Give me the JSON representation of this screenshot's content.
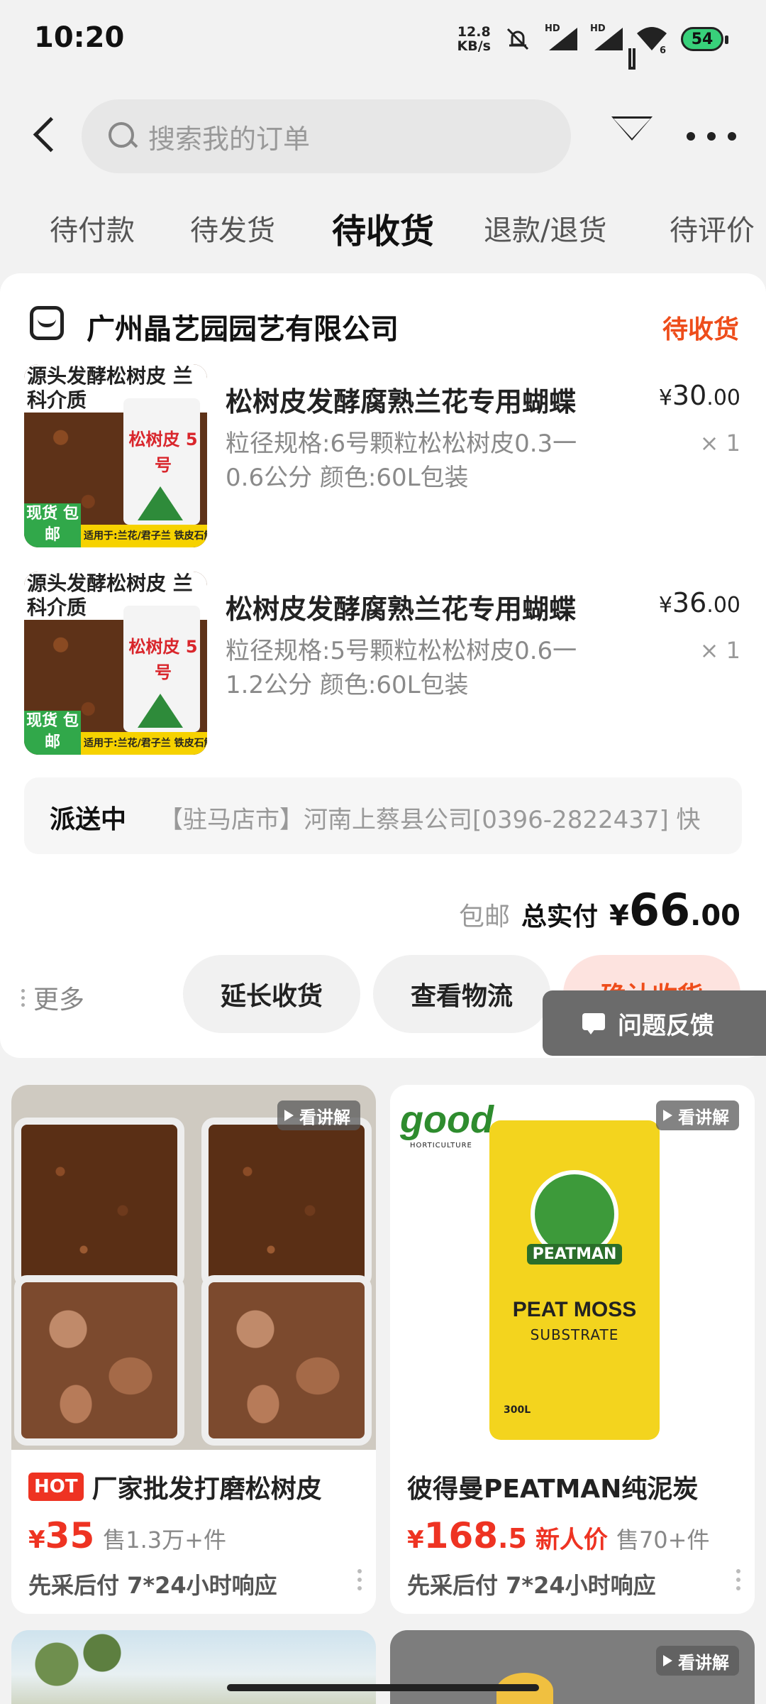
{
  "status_bar": {
    "time": "10:20",
    "net_speed_value": "12.8",
    "net_speed_unit": "KB/s",
    "sim1_label": "HD",
    "sim2_label": "HD",
    "wifi_label": "6",
    "battery": "54",
    "icons": [
      "mute-bell-icon",
      "signal-icon",
      "signal-icon",
      "wifi-icon",
      "battery-icon"
    ]
  },
  "top_bar": {
    "search_placeholder": "搜索我的订单",
    "icons": [
      "back-arrow-icon",
      "search-icon",
      "filter-icon",
      "more-dots-icon"
    ]
  },
  "tabs": [
    {
      "label": "待付款",
      "active": false
    },
    {
      "label": "待发货",
      "active": false
    },
    {
      "label": "待收货",
      "active": true
    },
    {
      "label": "退款/退货",
      "active": false
    },
    {
      "label": "待评价",
      "active": false
    }
  ],
  "order": {
    "shop_name": "广州晶艺园园艺有限公司",
    "status": "待收货",
    "products": [
      {
        "image_banner": "源头发酵松树皮 兰科介质",
        "image_bag_text": "松树皮 5号",
        "image_badge": "现货 包邮",
        "image_footer": "适用于:兰花/君子兰 铁皮石斛/蝴蝶兰",
        "title": "松树皮发酵腐熟兰花专用蝴蝶",
        "spec": "粒径规格:6号颗粒松松树皮0.3一0.6公分 颜色:60L包装",
        "price_currency": "¥",
        "price_int": "30",
        "price_dec": ".00",
        "qty": "× 1"
      },
      {
        "image_banner": "源头发酵松树皮 兰科介质",
        "image_bag_text": "松树皮 5号",
        "image_badge": "现货 包邮",
        "image_footer": "适用于:兰花/君子兰 铁皮石斛/蝴蝶兰",
        "title": "松树皮发酵腐熟兰花专用蝴蝶",
        "spec": "粒径规格:5号颗粒松松树皮0.6一1.2公分 颜色:60L包装",
        "price_currency": "¥",
        "price_int": "36",
        "price_dec": ".00",
        "qty": "× 1"
      }
    ],
    "delivery_label": "派送中",
    "delivery_text": "【驻马店市】河南上蔡县公司[0396-2822437] 快",
    "free_shipping": "包邮",
    "total_label": "总实付",
    "total_currency": "¥",
    "total_int": "66",
    "total_dec": ".00",
    "more_label": "更多",
    "buttons": {
      "extend": "延长收货",
      "logistics": "查看物流",
      "confirm": "确认收货"
    }
  },
  "feedback": {
    "label": "问题反馈"
  },
  "recommendations": [
    {
      "video_label": "看讲解",
      "tag": "HOT",
      "title": "厂家批发打磨松树皮",
      "price_currency": "¥",
      "price_int": "35",
      "price_dec": "",
      "sold": "售1.3万+件",
      "service": "先采后付   7*24小时响应"
    },
    {
      "video_label": "看讲解",
      "brand_logo": "good",
      "brand_sub": "HORTICULTURE",
      "bag_brand": "PEATMAN",
      "bag_title": "PEAT MOSS",
      "bag_sub": "SUBSTRATE",
      "bag_volume": "300L",
      "title": "彼得曼PEATMAN纯泥炭",
      "price_currency": "¥",
      "price_int": "168",
      "price_dec": ".5",
      "new_price_label": "新人价",
      "sold": "售70+件",
      "service": "先采后付   7*24小时响应"
    }
  ],
  "peek_video_label": "看讲解",
  "colors": {
    "accent": "#ee4d1b",
    "price_red": "#ee3322",
    "confirm_bg": "#fde3df",
    "background": "#f2f2f2"
  }
}
